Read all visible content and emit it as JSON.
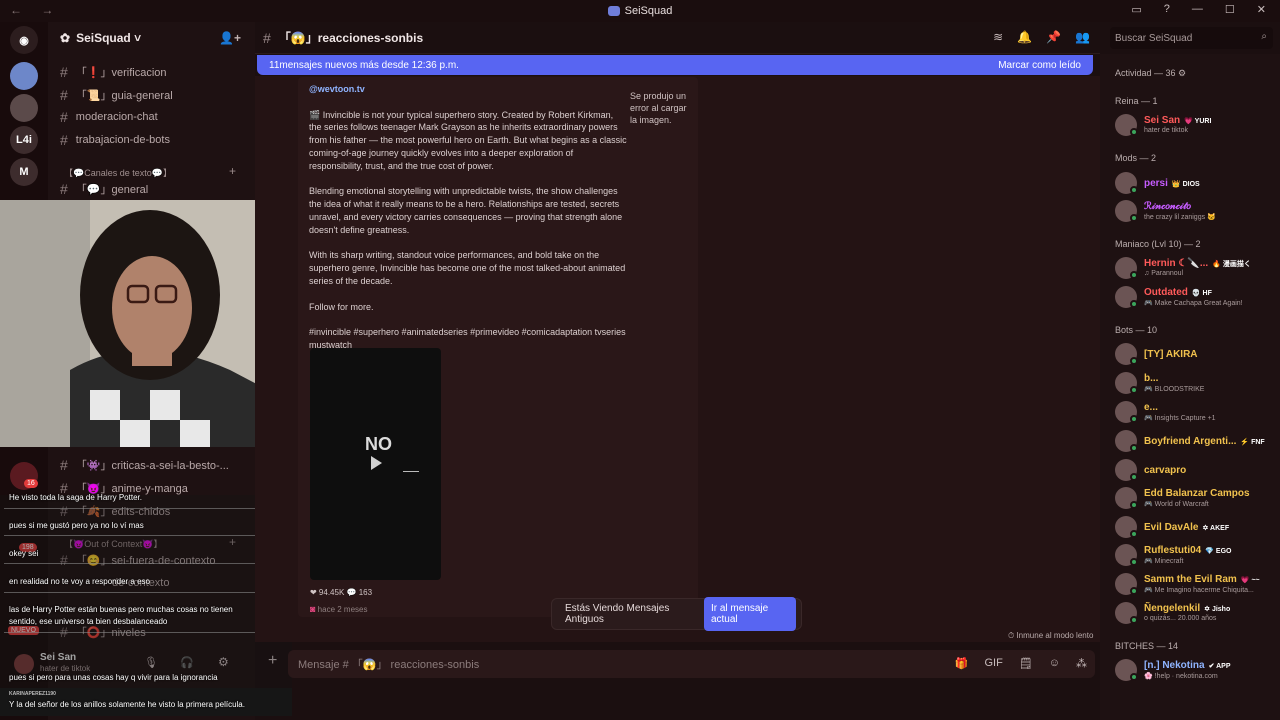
{
  "window": {
    "title": "SeiSquad",
    "nav": "← →",
    "controls": [
      "▭",
      "?",
      "—",
      "☐",
      "✕"
    ]
  },
  "guilds": {
    "items": [
      "M",
      "L4i"
    ],
    "badges": [
      "16",
      "198"
    ]
  },
  "server": {
    "name": "SeiSquad ˅"
  },
  "channels": {
    "items": [
      {
        "label": "「❗」verificacion"
      },
      {
        "label": "「📜」guia-general"
      },
      {
        "label": "moderacion-chat"
      },
      {
        "label": "trabajacion-de-bots"
      },
      {
        "label": "「💬」general"
      },
      {
        "label": "「👾」criticas-a-sei-la-besto-..."
      },
      {
        "label": "「😈」anime-y-manga"
      },
      {
        "label": "「🍂」edits-chidos"
      },
      {
        "label": "「😊」sei-fuera-de-contexto"
      },
      {
        "label": "de-contexto"
      },
      {
        "label": "「⭕」niveles"
      }
    ],
    "categories": [
      "【💬Canales de texto💬】",
      "【😈Out of Context😈】"
    ],
    "new_badge": "NUEVO"
  },
  "channel_header": {
    "title": "「😱」reacciones-sonbis",
    "icons": [
      "threads-icon",
      "bell-icon",
      "pin-icon",
      "members-icon"
    ]
  },
  "new_messages": {
    "text": "11mensajes nuevos más desde 12:36 p.m.",
    "action": "Marcar como leído"
  },
  "embed": {
    "author": "@wevtoon.tv",
    "paragraphs": [
      "🎬 Invincible is not your typical superhero story. Created by Robert Kirkman, the series follows teenager Mark Grayson as he inherits extraordinary powers from his father — the most powerful hero on Earth. But what begins as a classic coming-of-age journey quickly evolves into a deeper exploration of responsibility, trust, and the true cost of power.",
      "Blending emotional storytelling with unpredictable twists, the show challenges the idea of what it really means to be a hero. Relationships are tested, secrets unravel, and every victory carries consequences — proving that strength alone doesn't define greatness.",
      "With its sharp writing, standout voice performances, and bold take on the superhero genre, Invincible has become one of the most talked-about animated series of the decade.",
      "Follow for more.",
      "#invincible #superhero #animatedseries #primevideo #comicadaptation tvseries mustwatch"
    ],
    "error": "Se produjo un error al cargar la imagen.",
    "video_label": "NO",
    "likes": "❤ 94.45K",
    "comments": "💬 163",
    "ago": "hace 2 meses"
  },
  "old_messages": {
    "text": "Estás Viendo Mensajes Antiguos",
    "button": "Ir al mensaje actual"
  },
  "slowmode": "⏱ Inmune al modo lento",
  "composer": {
    "placeholder": "Mensaje # 「😱」 reacciones-sonbis",
    "tools": [
      "🎁",
      "GIF",
      "🗒",
      "☺",
      "⁂"
    ]
  },
  "search": {
    "placeholder": "Buscar SeiSquad"
  },
  "members": {
    "sections": [
      "Actividad — 36 ⚙",
      "Reina — 1",
      "Mods — 2",
      "Maniaco (Lvl 10) — 2",
      "Bots — 10",
      "BITCHES — 14"
    ],
    "list": [
      {
        "name": "Sei San",
        "tag": "💗 YURI",
        "status": "hater de tiktok",
        "color": "#ff5a5a"
      },
      {
        "name": "persi",
        "tag": "👑 DIOS",
        "status": "",
        "color": "#c65cff"
      },
      {
        "name": "ℛ𝒾𝓃𝒸𝑜𝓃𝒸𝒾𝓉𝑜",
        "tag": "",
        "status": "the crazy lil zaniggs 🐱",
        "color": "#c65cff"
      },
      {
        "name": "Hernin ☾🔪...",
        "tag": "🔥 漫画描く",
        "status": "♫ Parannoul",
        "color": "#ff5a5a"
      },
      {
        "name": "Outdated",
        "tag": "💀 HF",
        "status": "🎮 Make Cachapa Great Again!",
        "color": "#ff5a5a"
      },
      {
        "name": "[TY] AKIRA",
        "tag": "",
        "status": "",
        "color": "#f1c24e"
      },
      {
        "name": "b...",
        "tag": "",
        "status": "🎮 BLOODSTRIKE",
        "color": "#f1c24e"
      },
      {
        "name": "e...",
        "tag": "",
        "status": "🎮 Insights Capture +1",
        "color": "#f1c24e"
      },
      {
        "name": "Boyfriend Argenti...",
        "tag": "⚡ FNF",
        "status": "",
        "color": "#f1c24e"
      },
      {
        "name": "carvapro",
        "tag": "",
        "status": "",
        "color": "#f1c24e"
      },
      {
        "name": "Edd Balanzar Campos",
        "tag": "",
        "status": "🎮 World of Warcraft",
        "color": "#f1c24e"
      },
      {
        "name": "Evil DavAle",
        "tag": "✡ AKEF",
        "status": "",
        "color": "#f1c24e"
      },
      {
        "name": "Ruflestuti04",
        "tag": "💎 EGO",
        "status": "🎮 Minecraft",
        "color": "#f1c24e"
      },
      {
        "name": "Samm the Evil Ram",
        "tag": "💗 ~~",
        "status": "🎮 Me Imagino hacerme Chiquita...",
        "color": "#f1c24e"
      },
      {
        "name": "Ñengelenkil",
        "tag": "✡ Jisho",
        "status": "o quizás... 20.000 años",
        "color": "#f1c24e"
      },
      {
        "name": "[n.] Nekotina",
        "tag": "✔ APP",
        "status": "🌸 !help · nekotina.com",
        "color": "#8fb4ff"
      }
    ]
  },
  "user": {
    "name": "Sei San",
    "status": "hater de tiktok"
  },
  "chat_overlay": {
    "names": [
      "KARINAPEREZ1190"
    ],
    "messages": [
      "He visto toda la saga de Harry Potter.",
      "pues si me gustó pero ya no lo ví mas",
      "okey sei",
      "en realidad no te voy a responder a eso",
      "las de Harry Potter están buenas pero muchas cosas no tienen",
      "sentido, ese universo ta bien desbalanceado",
      "pues si pero para unas cosas hay q vivir para la ignorancia",
      "Y la del señor de los anillos solamente he visto la primera película."
    ]
  }
}
